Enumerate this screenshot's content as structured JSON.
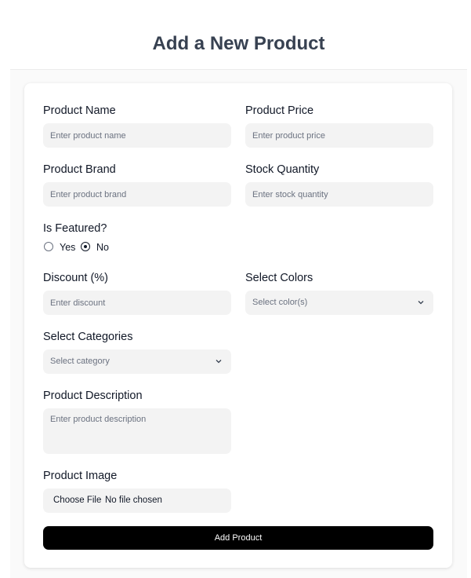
{
  "page": {
    "title": "Add a New Product"
  },
  "form": {
    "product_name": {
      "label": "Product Name",
      "placeholder": "Enter product name"
    },
    "product_price": {
      "label": "Product Price",
      "placeholder": "Enter product price"
    },
    "product_brand": {
      "label": "Product Brand",
      "placeholder": "Enter product brand"
    },
    "stock_quantity": {
      "label": "Stock Quantity",
      "placeholder": "Enter stock quantity"
    },
    "is_featured": {
      "label": "Is Featured?",
      "options": [
        {
          "label": "Yes",
          "checked": false
        },
        {
          "label": "No",
          "checked": true
        }
      ]
    },
    "discount": {
      "label": "Discount (%)",
      "placeholder": "Enter discount"
    },
    "colors": {
      "label": "Select Colors",
      "value": "Select color(s)"
    },
    "categories": {
      "label": "Select Categories",
      "value": "Select category"
    },
    "description": {
      "label": "Product Description",
      "placeholder": "Enter product description"
    },
    "image": {
      "label": "Product Image",
      "button": "Choose File",
      "status": "No file chosen"
    },
    "submit_label": "Add Product"
  },
  "icons": {
    "sidebar_toggle": "sidebar-toggle-icon",
    "chevron": "chevron-down-icon"
  },
  "colors": {
    "accent": "#000000",
    "field_bg": "#f3f3f3"
  }
}
